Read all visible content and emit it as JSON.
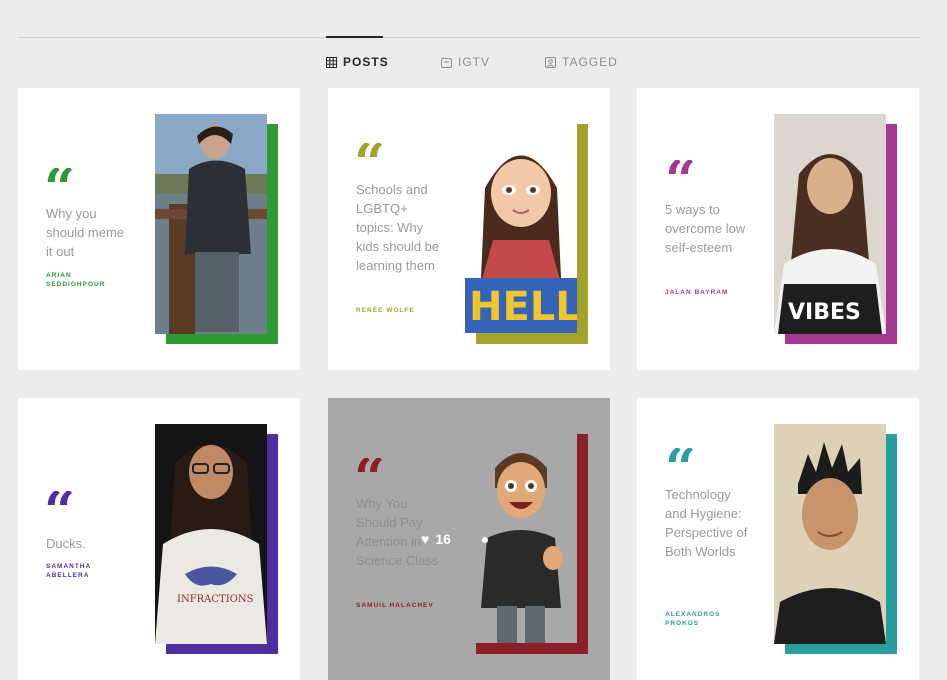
{
  "tabs": [
    {
      "label": "POSTS",
      "icon": "grid-icon"
    },
    {
      "label": "IGTV",
      "icon": "igtv-icon"
    },
    {
      "label": "TAGGED",
      "icon": "tagged-icon"
    }
  ],
  "posts": [
    {
      "title": "Why you should meme it out",
      "author": "ARIAN SEDDIGHPOUR",
      "color": "#2e9a34"
    },
    {
      "title": "Schools and LGBTQ+ topics: Why kids should be learning them",
      "author": "RENÉE WOLFE",
      "color": "#a3a22c"
    },
    {
      "title": "5 ways to overcome low self-esteem",
      "author": "JALAN BAYRAM",
      "color": "#a23a92"
    },
    {
      "title": "Ducks.",
      "author": "SAMANTHA ABELLERA",
      "color": "#4f2fa0"
    },
    {
      "title": "Why You Should Pay Attention in Science Class",
      "author": "SAMUIL HALACHEV",
      "color": "#8c2026",
      "likes": "16"
    },
    {
      "title": "Technology and Hygiene: Perspective of Both Worlds",
      "author": "ALEXANDROS PROKOS",
      "color": "#2a9e9e"
    }
  ]
}
